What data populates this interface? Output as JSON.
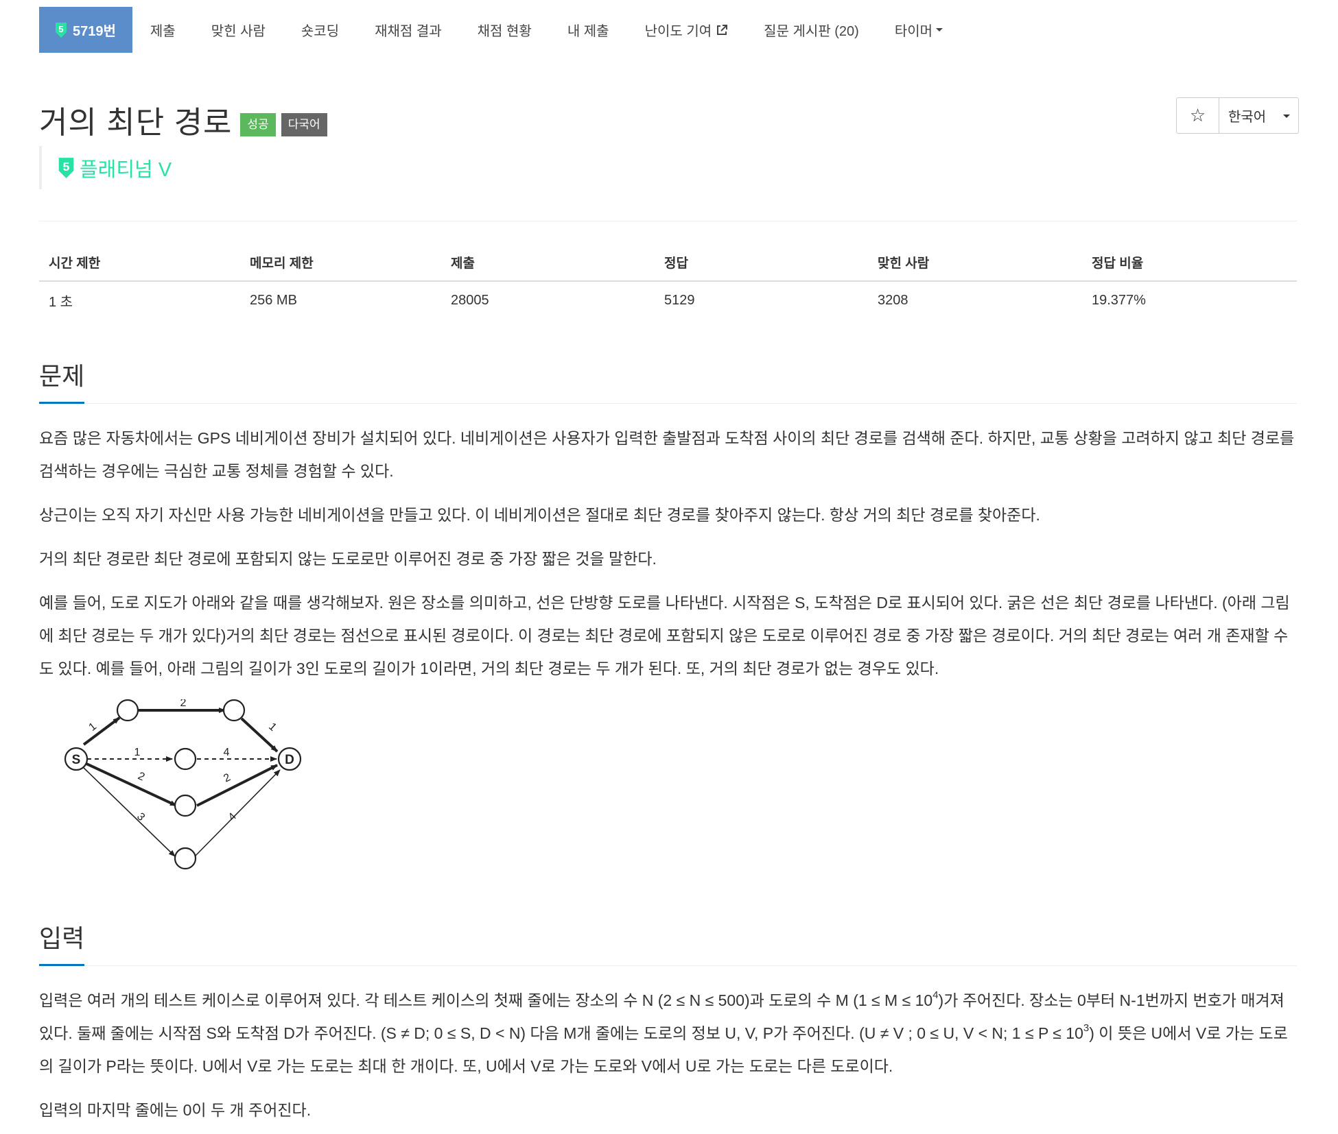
{
  "problem_nav": {
    "number_label": "5719번",
    "tier_digit": "5",
    "items": [
      "제출",
      "맞힌 사람",
      "숏코딩",
      "재채점 결과",
      "채점 현황",
      "내 제출",
      "난이도 기여",
      "질문 게시판 (20)",
      "타이머"
    ]
  },
  "header": {
    "title": "거의 최단 경로",
    "badge_success": "성공",
    "badge_lang": "다국어",
    "tier_digit": "5",
    "tier_label": "플래티넘 V",
    "star_icon": "☆",
    "language": "한국어"
  },
  "colors": {
    "nav_active": "#5b8dcb",
    "tier": "#27e2a4",
    "success": "#5cb85c",
    "lang_badge": "#666666",
    "section_underline": "#0076c0"
  },
  "stats": {
    "headers": [
      "시간 제한",
      "메모리 제한",
      "제출",
      "정답",
      "맞힌 사람",
      "정답 비율"
    ],
    "values": [
      "1 초",
      "256 MB",
      "28005",
      "5129",
      "3208",
      "19.377%"
    ]
  },
  "problem": {
    "title": "문제",
    "p1": "요즘 많은 자동차에서는 GPS 네비게이션 장비가 설치되어 있다. 네비게이션은 사용자가 입력한 출발점과 도착점 사이의 최단 경로를 검색해 준다. 하지만, 교통 상황을 고려하지 않고 최단 경로를 검색하는 경우에는 극심한 교통 정체를 경험할 수 있다.",
    "p2": "상근이는 오직 자기 자신만 사용 가능한 네비게이션을 만들고 있다. 이 네비게이션은 절대로 최단 경로를 찾아주지 않는다. 항상 거의 최단 경로를 찾아준다.",
    "p3": "거의 최단 경로란 최단 경로에 포함되지 않는 도로로만 이루어진 경로 중 가장 짧은 것을 말한다.",
    "p4": "예를 들어, 도로 지도가 아래와 같을 때를 생각해보자. 원은 장소를 의미하고, 선은 단방향 도로를 나타낸다. 시작점은 S, 도착점은 D로 표시되어 있다. 굵은 선은 최단 경로를 나타낸다. (아래 그림에 최단 경로는 두 개가 있다)거의 최단 경로는 점선으로 표시된 경로이다. 이 경로는 최단 경로에 포함되지 않은 도로로 이루어진 경로 중 가장 짧은 경로이다. 거의 최단 경로는 여러 개 존재할 수도 있다. 예를 들어, 아래 그림의 길이가 3인 도로의 길이가 1이라면, 거의 최단 경로는 두 개가 된다. 또, 거의 최단 경로가 없는 경우도 있다."
  },
  "figure": {
    "node_s": "S",
    "node_d": "D",
    "edge_labels": [
      "1",
      "2",
      "1",
      "1",
      "4",
      "2",
      "2",
      "3",
      "4"
    ]
  },
  "input": {
    "title": "입력",
    "p1_a": "입력은 여러 개의 테스트 케이스로 이루어져 있다. 각 테스트 케이스의 첫째 줄에는 장소의 수 N (2 ≤ N ≤ 500)과 도로의 수 M (1 ≤ M ≤ 10",
    "p1_sup1": "4",
    "p1_b": ")가 주어진다. 장소는 0부터 N-1번까지 번호가 매겨져 있다. 둘째 줄에는 시작점 S와 도착점 D가 주어진다. (S ≠ D; 0 ≤ S, D < N) 다음 M개 줄에는 도로의 정보 U, V, P가 주어진다. (U ≠ V ; 0 ≤ U, V < N; 1 ≤ P ≤ 10",
    "p1_sup2": "3",
    "p1_c": ") 이 뜻은 U에서 V로 가는 도로의 길이가 P라는 뜻이다. U에서 V로 가는 도로는 최대 한 개이다. 또, U에서 V로 가는 도로와 V에서 U로 가는 도로는 다른 도로이다.",
    "p2": "입력의 마지막 줄에는 0이 두 개 주어진다."
  }
}
